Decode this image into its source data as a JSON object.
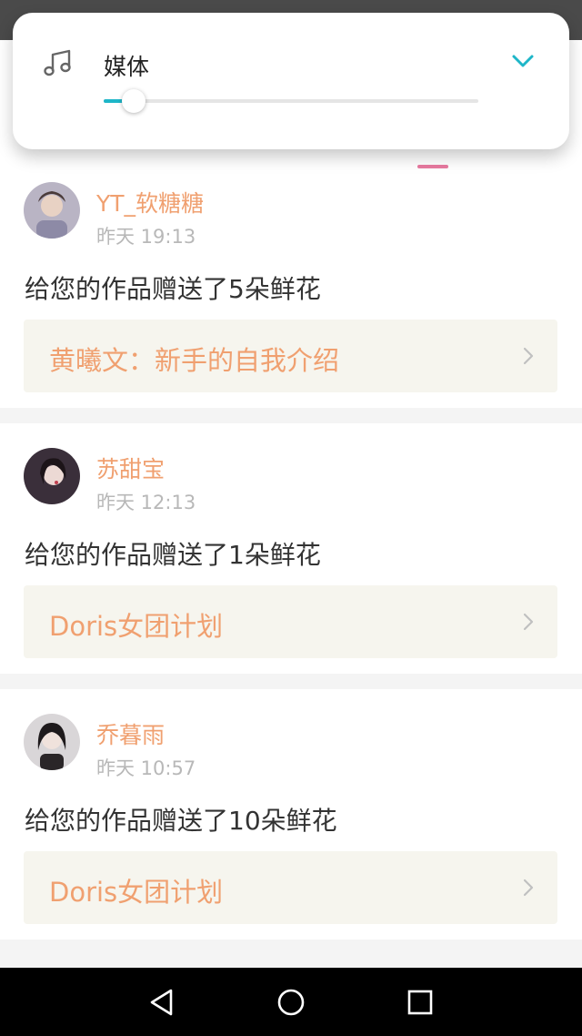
{
  "media_panel": {
    "title": "媒体",
    "icon": "music-note-icon",
    "expand_icon": "chevron-down-icon",
    "volume_level": 0.08,
    "accent_color": "#1eb6c8"
  },
  "tab_indicator_color": "#e87aa0",
  "notifications": [
    {
      "user": "YT_软糖糖",
      "time": "昨天 19:13",
      "message": "给您的作品赠送了5朵鲜花",
      "work_title": "黄曦文：新手的自我介绍"
    },
    {
      "user": "苏甜宝",
      "time": "昨天 12:13",
      "message": "给您的作品赠送了1朵鲜花",
      "work_title": "Doris女团计划"
    },
    {
      "user": "乔暮雨",
      "time": "昨天 10:57",
      "message": "给您的作品赠送了10朵鲜花",
      "work_title": "Doris女团计划"
    }
  ],
  "colors": {
    "username": "#f0a070",
    "work_title": "#f0a070",
    "work_bg": "#f6f5ee"
  },
  "nav": {
    "back_icon": "back-triangle-icon",
    "home_icon": "home-circle-icon",
    "recents_icon": "recents-square-icon"
  }
}
